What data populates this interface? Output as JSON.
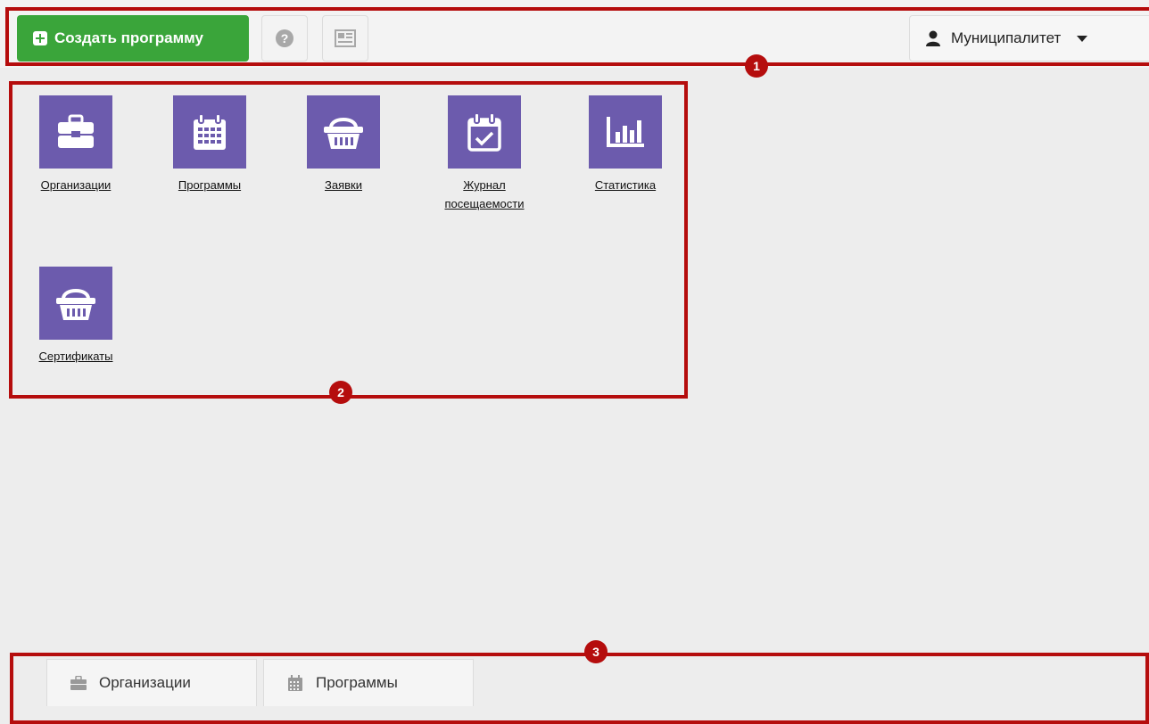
{
  "toolbar": {
    "create_label": "Создать программу",
    "help_symbol": "?",
    "user_label": "Муниципалитет"
  },
  "tiles": [
    {
      "label": "Организации",
      "icon": "briefcase-icon"
    },
    {
      "label": "Программы",
      "icon": "calendar-icon"
    },
    {
      "label": "Заявки",
      "icon": "basket-icon"
    },
    {
      "label": "Журнал посещаемости",
      "icon": "calendar-check-icon"
    },
    {
      "label": "Статистика",
      "icon": "bar-chart-icon"
    },
    {
      "label": "Сертификаты",
      "icon": "basket-icon"
    }
  ],
  "tabs": [
    {
      "label": "Организации",
      "icon": "briefcase-icon"
    },
    {
      "label": "Программы",
      "icon": "calendar-icon"
    }
  ],
  "annotations": {
    "b1": "1",
    "b2": "2",
    "b3": "3"
  },
  "colors": {
    "accent": "#3aa53a",
    "tile": "#6c5bad",
    "annotation": "#b50d0d"
  }
}
